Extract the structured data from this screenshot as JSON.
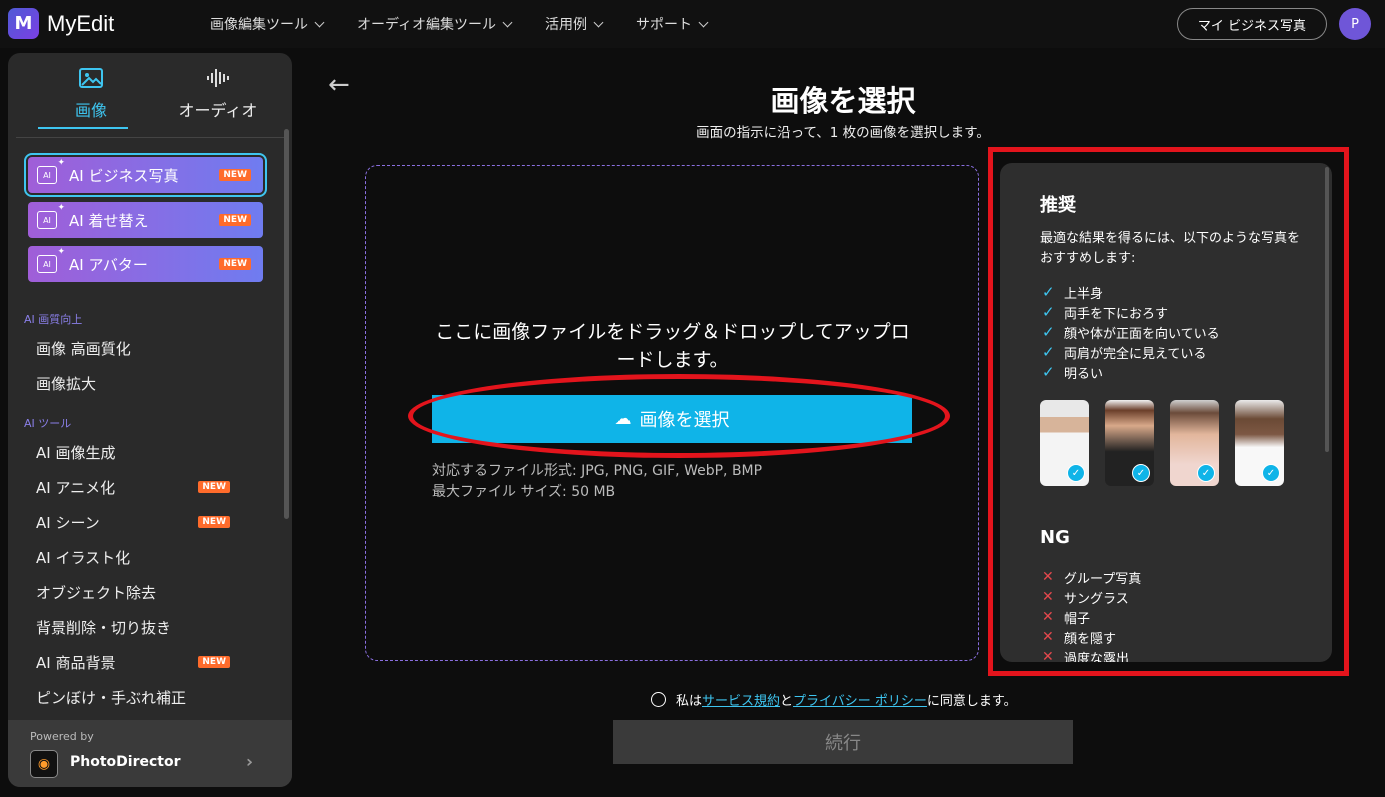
{
  "brand": {
    "name": "MyEdit",
    "mark": "M"
  },
  "nav": [
    "画像編集ツール",
    "オーディオ編集ツール",
    "活用例",
    "サポート"
  ],
  "header": {
    "my_business_label": "マイ ビジネス写真",
    "avatar_initial": "P"
  },
  "sidebar": {
    "tabs": [
      {
        "label": "画像"
      },
      {
        "label": "オーディオ"
      }
    ],
    "ai_buttons": [
      {
        "label": "AI ビジネス写真",
        "badge": "NEW"
      },
      {
        "label": "AI 着せ替え",
        "badge": "NEW"
      },
      {
        "label": "AI アバター",
        "badge": "NEW"
      }
    ],
    "section_quality": "AI 画質向上",
    "quality_items": [
      "画像 高画質化",
      "画像拡大"
    ],
    "section_tools": "AI ツール",
    "tool_items": [
      {
        "label": "AI 画像生成",
        "badge": ""
      },
      {
        "label": "AI アニメ化",
        "badge": "NEW"
      },
      {
        "label": "AI シーン",
        "badge": "NEW"
      },
      {
        "label": "AI イラスト化",
        "badge": ""
      },
      {
        "label": "オブジェクト除去",
        "badge": ""
      },
      {
        "label": "背景削除・切り抜き",
        "badge": ""
      },
      {
        "label": "AI 商品背景",
        "badge": "NEW"
      },
      {
        "label": "ピンぼけ・手ぶれ補正",
        "badge": ""
      }
    ],
    "powered_by": "Powered by",
    "product_name": "PhotoDirector"
  },
  "main": {
    "title": "画像を選択",
    "subtitle": "画面の指示に沿って、1 枚の画像を選択します。",
    "drop_text": "ここに画像ファイルをドラッグ＆ドロップしてアップロードします。",
    "select_button": "画像を選択",
    "formats": "対応するファイル形式: JPG, PNG, GIF, WebP, BMP",
    "max_size": "最大ファイル サイズ: 50 MB"
  },
  "recommend": {
    "title": "推奨",
    "description": "最適な結果を得るには、以下のような写真をおすすめします:",
    "checks": [
      "上半身",
      "両手を下におろす",
      "顔や体が正面を向いている",
      "両肩が完全に見えている",
      "明るい"
    ],
    "ng_title": "NG",
    "ng_items": [
      "グループ写真",
      "サングラス",
      "帽子",
      "顔を隠す",
      "過度な露出"
    ]
  },
  "agreement": {
    "prefix": "私は",
    "terms": "サービス規約",
    "and": "と",
    "privacy": "プライバシー ポリシー",
    "suffix": "に同意します。"
  },
  "continue_label": "続行",
  "colors": {
    "accent": "#0fb4e8",
    "highlight": "#e3141c",
    "badge": "#ff6b2b"
  }
}
